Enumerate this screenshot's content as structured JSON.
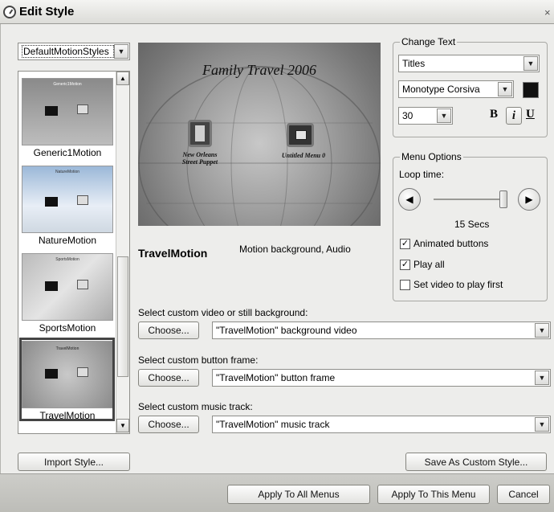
{
  "window": {
    "title": "Edit Style",
    "close_glyph": "×"
  },
  "style_dropdown": {
    "value": "DefaultMotionStyles"
  },
  "style_list": [
    {
      "thumb_title": "Generic1Motion",
      "label": "Generic1Motion"
    },
    {
      "thumb_title": "NatureMotion",
      "label": "NatureMotion"
    },
    {
      "thumb_title": "SportsMotion",
      "label": "SportsMotion"
    },
    {
      "thumb_title": "TravelMotion",
      "label": "TravelMotion"
    }
  ],
  "preview": {
    "title": "Family Travel 2006",
    "button1_caption_line1": "New Orleans",
    "button1_caption_line2": "Street Puppet",
    "button2_caption": "Untitled Menu 0"
  },
  "style_info": {
    "name": "TravelMotion",
    "description": "Motion background, Audio"
  },
  "change_text": {
    "group_label": "Change Text",
    "target": "Titles",
    "font": "Monotype Corsiva",
    "size": "30",
    "color": "#111111",
    "bold_label": "B",
    "italic_label": "i",
    "underline_label": "U"
  },
  "menu_options": {
    "group_label": "Menu Options",
    "loop_label": "Loop time:",
    "loop_value_text": "15 Secs",
    "slider_fraction": 1.0,
    "animated_buttons": {
      "label": "Animated buttons",
      "checked": true
    },
    "play_all": {
      "label": "Play all",
      "checked": true
    },
    "video_first": {
      "label": "Set video to play first",
      "checked": false
    }
  },
  "custom": {
    "background_label": "Select custom video or still background:",
    "background_value": "\"TravelMotion\" background video",
    "frame_label": "Select custom button frame:",
    "frame_value": "\"TravelMotion\" button frame",
    "music_label": "Select custom music track:",
    "music_value": "\"TravelMotion\" music track",
    "choose_label": "Choose..."
  },
  "buttons": {
    "import": "Import Style...",
    "save_custom": "Save As Custom Style...",
    "apply_all": "Apply To All Menus",
    "apply_this": "Apply To This Menu",
    "cancel": "Cancel"
  },
  "icons": {
    "check": "✓",
    "arrow_down": "▼",
    "arrow_up": "▲",
    "left": "◀",
    "right": "▶"
  }
}
